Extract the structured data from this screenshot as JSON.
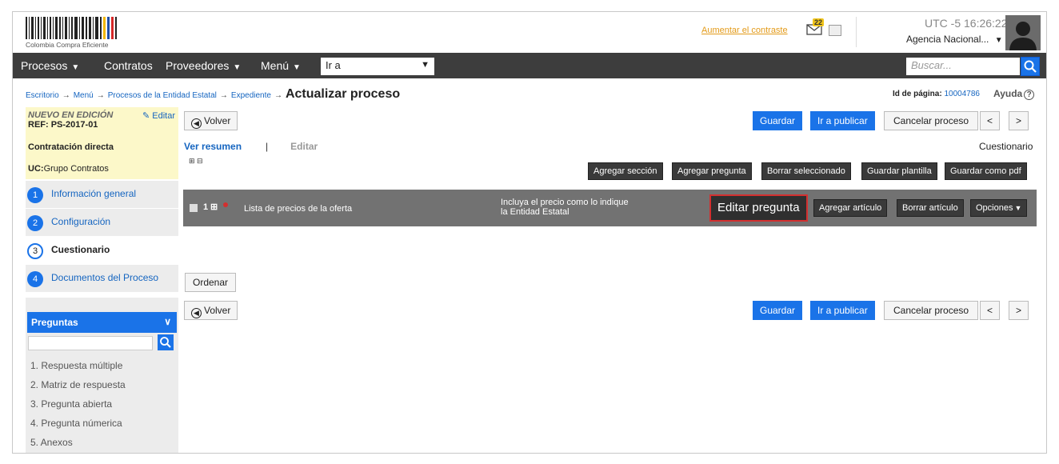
{
  "header": {
    "logo_text": "Colombia Compra Eficiente",
    "contrast_link": "Aumentar el contraste",
    "notifications_count": "22",
    "timezone": "UTC -5 16:26:22",
    "agency": "Agencia Nacional...",
    "agency_caret": "▼"
  },
  "nav": {
    "procesos": "Procesos",
    "contratos": "Contratos",
    "proveedores": "Proveedores",
    "menu": "Menú",
    "caret": "▼",
    "goto_value": "Ir a",
    "search_placeholder": "Buscar..."
  },
  "breadcrumb": {
    "items": [
      "Escritorio",
      "Menú",
      "Procesos de la Entidad Estatal",
      "Expediente"
    ],
    "arrow": "→",
    "current": "Actualizar proceso"
  },
  "page_id": {
    "label": "Id de página:",
    "value": "10004786"
  },
  "help": {
    "label": "Ayuda",
    "icon": "?"
  },
  "sidebar": {
    "status": "NUEVO EN EDICIÓN",
    "edit": "Editar",
    "ref": "REF: PS-2017-01",
    "contract_type": "Contratación directa",
    "uc_label": "UC:",
    "uc_value": "Grupo Contratos",
    "steps": [
      {
        "num": "1",
        "label": "Información general"
      },
      {
        "num": "2",
        "label": "Configuración"
      },
      {
        "num": "3",
        "label": "Cuestionario"
      },
      {
        "num": "4",
        "label": "Documentos del Proceso"
      }
    ],
    "questions_title": "Preguntas",
    "question_types": [
      "1. Respuesta múltiple",
      "2. Matriz de respuesta",
      "3. Pregunta abierta",
      "4. Pregunta númerica",
      "5. Anexos"
    ]
  },
  "toolbar": {
    "volver": "Volver",
    "guardar": "Guardar",
    "ir_publicar": "Ir a publicar",
    "cancelar": "Cancelar proceso",
    "prev": "<",
    "next": ">"
  },
  "tabs": {
    "resumen": "Ver resumen",
    "sep": "|",
    "editar": "Editar",
    "section": "Cuestionario"
  },
  "expand_icons": "⊞ ⊟",
  "actions": {
    "agregar_seccion": "Agregar sección",
    "agregar_pregunta": "Agregar pregunta",
    "borrar_seleccionado": "Borrar seleccionado",
    "guardar_plantilla": "Guardar plantilla",
    "guardar_pdf": "Guardar como pdf"
  },
  "question": {
    "number": "1",
    "title": "Lista de precios de la oferta",
    "desc_line1": "Incluya el precio como lo indique",
    "desc_line2": "la Entidad Estatal",
    "editar": "Editar pregunta",
    "agregar_articulo": "Agregar artículo",
    "borrar_articulo": "Borrar artículo",
    "opciones": "Opciones"
  },
  "ordenar": "Ordenar"
}
